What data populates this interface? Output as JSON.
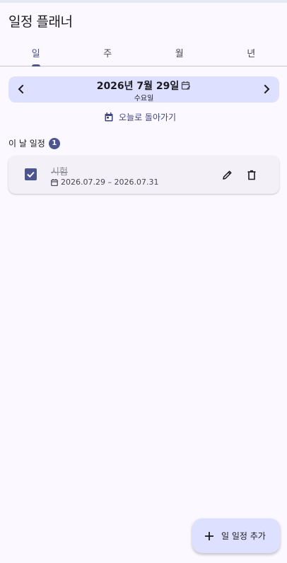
{
  "app": {
    "title": "일정 플래너"
  },
  "tabs": [
    {
      "label": "일",
      "active": true
    },
    {
      "label": "주",
      "active": false
    },
    {
      "label": "월",
      "active": false
    },
    {
      "label": "년",
      "active": false
    }
  ],
  "date_nav": {
    "date": "2026년 7월 29일",
    "weekday": "수요일",
    "prev_icon": "chevron-left-icon",
    "next_icon": "chevron-right-icon"
  },
  "today_button": {
    "label": "오늘로 돌아가기",
    "icon": "calendar-today-icon"
  },
  "section": {
    "title": "이 날 일정",
    "count": "1"
  },
  "events": [
    {
      "title": "시험",
      "range": "2026.07.29 – 2026.07.31",
      "completed": true
    }
  ],
  "fab": {
    "label": "일 일정 추가",
    "icon": "plus-icon"
  },
  "colors": {
    "background": "#fcf8ff",
    "primary": "#4d5590",
    "primary_container": "#dde0ff",
    "card": "#f3f0f7",
    "divider": "#c7c5d0"
  }
}
